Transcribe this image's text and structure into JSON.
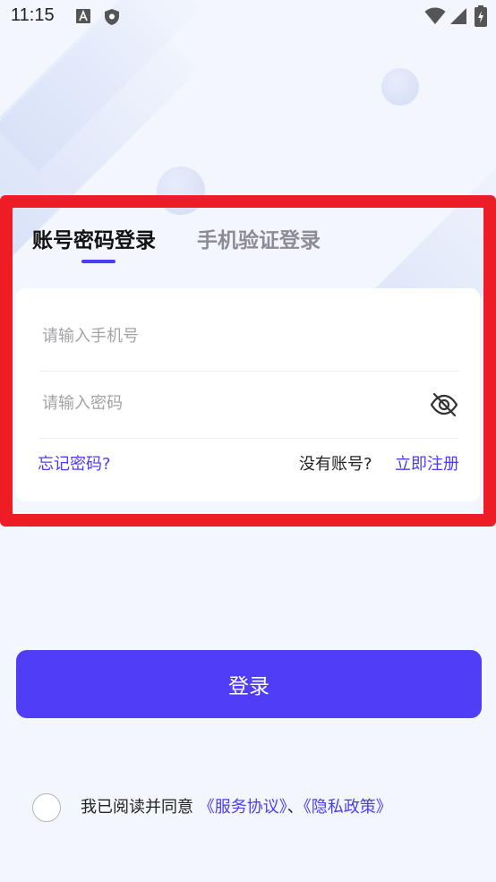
{
  "status_bar": {
    "time": "11:15",
    "icons": [
      "a-notification-icon",
      "shield-icon",
      "wifi-icon",
      "signal-icon",
      "battery-icon"
    ]
  },
  "tabs": [
    {
      "label": "账号密码登录",
      "active": true
    },
    {
      "label": "手机验证登录",
      "active": false
    }
  ],
  "form": {
    "phone_placeholder": "请输入手机号",
    "phone_value": "",
    "password_placeholder": "请输入密码",
    "password_value": "",
    "forgot_label": "忘记密码?",
    "no_account_label": "没有账号?",
    "register_label": "立即注册"
  },
  "login_button": "登录",
  "agreement": {
    "checked": false,
    "text": "我已阅读并同意",
    "service_link": "《服务协议》",
    "separator": "、",
    "privacy_link": "《隐私政策》"
  },
  "colors": {
    "accent": "#4b3cf6",
    "button": "#4f3df8",
    "highlight_border": "#ee1c25",
    "background": "#f3f6fd"
  }
}
